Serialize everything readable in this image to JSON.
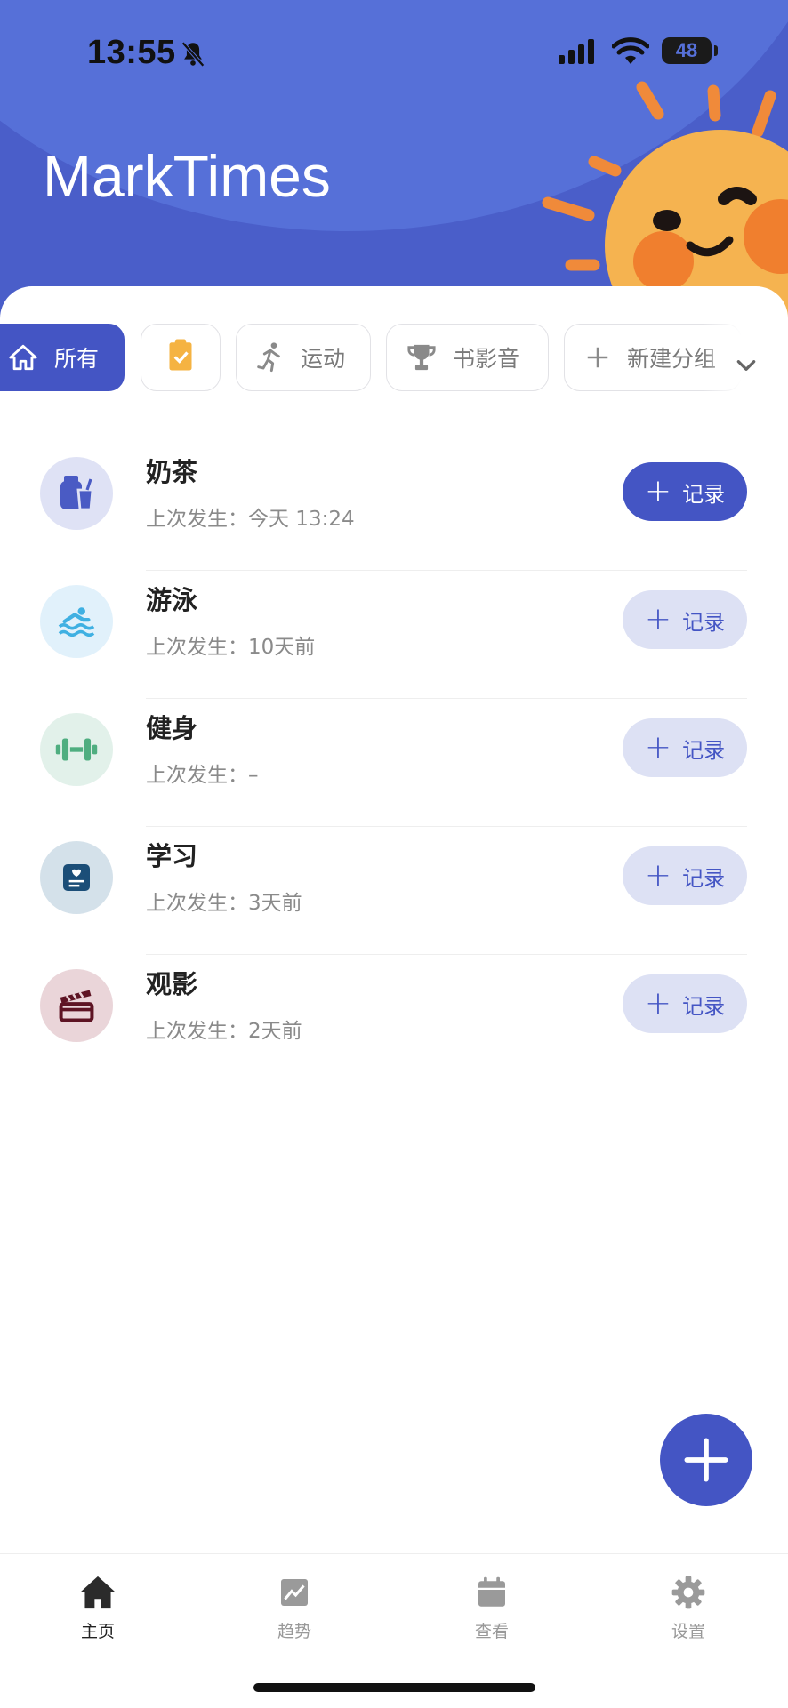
{
  "status_bar": {
    "time": "13:55",
    "battery": "48"
  },
  "app_title": "MarkTimes",
  "categories": [
    {
      "label": "所有",
      "icon": "home-icon",
      "active": true
    },
    {
      "label": "",
      "icon": "clipboard-check-icon",
      "active": false
    },
    {
      "label": "运动",
      "icon": "running-icon",
      "active": false
    },
    {
      "label": "书影音",
      "icon": "trophy-icon",
      "active": false
    },
    {
      "label": "新建分组",
      "icon": "plus-icon",
      "active": false
    }
  ],
  "last_prefix": "上次发生：",
  "record_label": "记录",
  "items": [
    {
      "name": "奶茶",
      "last": "上次发生：今天 13:24",
      "icon": "milk-tea-icon",
      "bg": "#dfe2f5",
      "color": "#4a5bc4",
      "primary": true
    },
    {
      "name": "游泳",
      "last": "上次发生：10天前",
      "icon": "swimming-icon",
      "bg": "#e1f1fb",
      "color": "#3fb0e2",
      "primary": false
    },
    {
      "name": "健身",
      "last": "上次发生：–",
      "icon": "dumbbell-icon",
      "bg": "#e2f1ea",
      "color": "#4fae80",
      "primary": false
    },
    {
      "name": "学习",
      "last": "上次发生：3天前",
      "icon": "notebook-icon",
      "bg": "#d4e1ea",
      "color": "#1b4e78",
      "primary": false
    },
    {
      "name": "观影",
      "last": "上次发生：2天前",
      "icon": "clapperboard-icon",
      "bg": "#ead5d9",
      "color": "#5e1424",
      "primary": false
    }
  ],
  "tabbar": [
    {
      "label": "主页",
      "icon": "home-icon",
      "active": true
    },
    {
      "label": "趋势",
      "icon": "trend-chart-icon",
      "active": false
    },
    {
      "label": "查看",
      "icon": "calendar-icon",
      "active": false
    },
    {
      "label": "设置",
      "icon": "gear-icon",
      "active": false
    }
  ],
  "colors": {
    "primary": "#4455c4",
    "header": "#4a5ec9",
    "sun": "#f5b350"
  }
}
